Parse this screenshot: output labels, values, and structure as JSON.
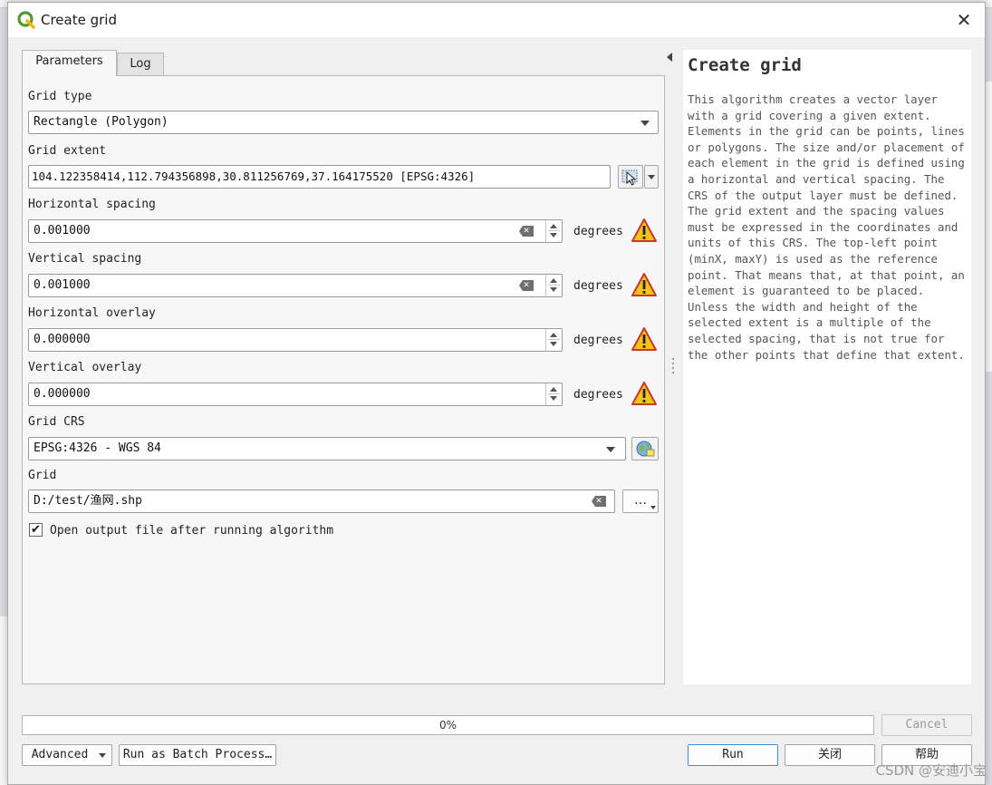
{
  "window": {
    "title": "Create grid",
    "close_glyph": "✕"
  },
  "tabs": [
    {
      "label": "Parameters"
    },
    {
      "label": "Log"
    }
  ],
  "parameters": {
    "grid_type": {
      "label": "Grid type",
      "value": "Rectangle (Polygon)"
    },
    "grid_extent": {
      "label": "Grid extent",
      "value": "104.122358414,112.794356898,30.811256769,37.164175520 [EPSG:4326]"
    },
    "horizontal_spacing": {
      "label": "Horizontal spacing",
      "value": "0.001000",
      "unit": "degrees"
    },
    "vertical_spacing": {
      "label": "Vertical spacing",
      "value": "0.001000",
      "unit": "degrees"
    },
    "horizontal_overlay": {
      "label": "Horizontal overlay",
      "value": "0.000000",
      "unit": "degrees"
    },
    "vertical_overlay": {
      "label": "Vertical overlay",
      "value": "0.000000",
      "unit": "degrees"
    },
    "grid_crs": {
      "label": "Grid CRS",
      "value": "EPSG:4326 - WGS 84"
    },
    "grid_output": {
      "label": "Grid",
      "value": "D:/test/渔网.shp",
      "browse_label": "…"
    },
    "open_output": {
      "label": "Open output file after running algorithm",
      "checked": true,
      "check_glyph": "✔"
    }
  },
  "help": {
    "title": "Create grid",
    "body": "This algorithm creates a vector layer\nwith a grid covering a given extent.\nElements in the grid can be points, lines\nor polygons. The size and/or placement of\neach element in the grid is defined using\na horizontal and vertical spacing. The\nCRS of the output layer must be defined.\nThe grid extent and the spacing values\nmust be expressed in the coordinates and\nunits of this CRS. The top-left point\n(minX, maxY) is used as the reference\npoint. That means that, at that point, an\nelement is guaranteed to be placed.\nUnless the width and height of the\nselected extent is a multiple of the\nselected spacing, that is not true for\nthe other points that define that extent."
  },
  "progress": {
    "value": 0,
    "label": "0%"
  },
  "buttons": {
    "cancel": "Cancel",
    "advanced": "Advanced",
    "batch": "Run as Batch Process…",
    "run": "Run",
    "close": "关闭",
    "help": "帮助"
  },
  "watermark": "CSDN @安迪小宝",
  "icons": {
    "app": "qgis-icon",
    "warning": "warning-icon",
    "map_select": "map-select-icon",
    "crs": "globe-crs-icon"
  },
  "colors": {
    "accent": "#3d8ee0",
    "warning_fill": "#f5c21b",
    "qgis_green": "#589632"
  }
}
